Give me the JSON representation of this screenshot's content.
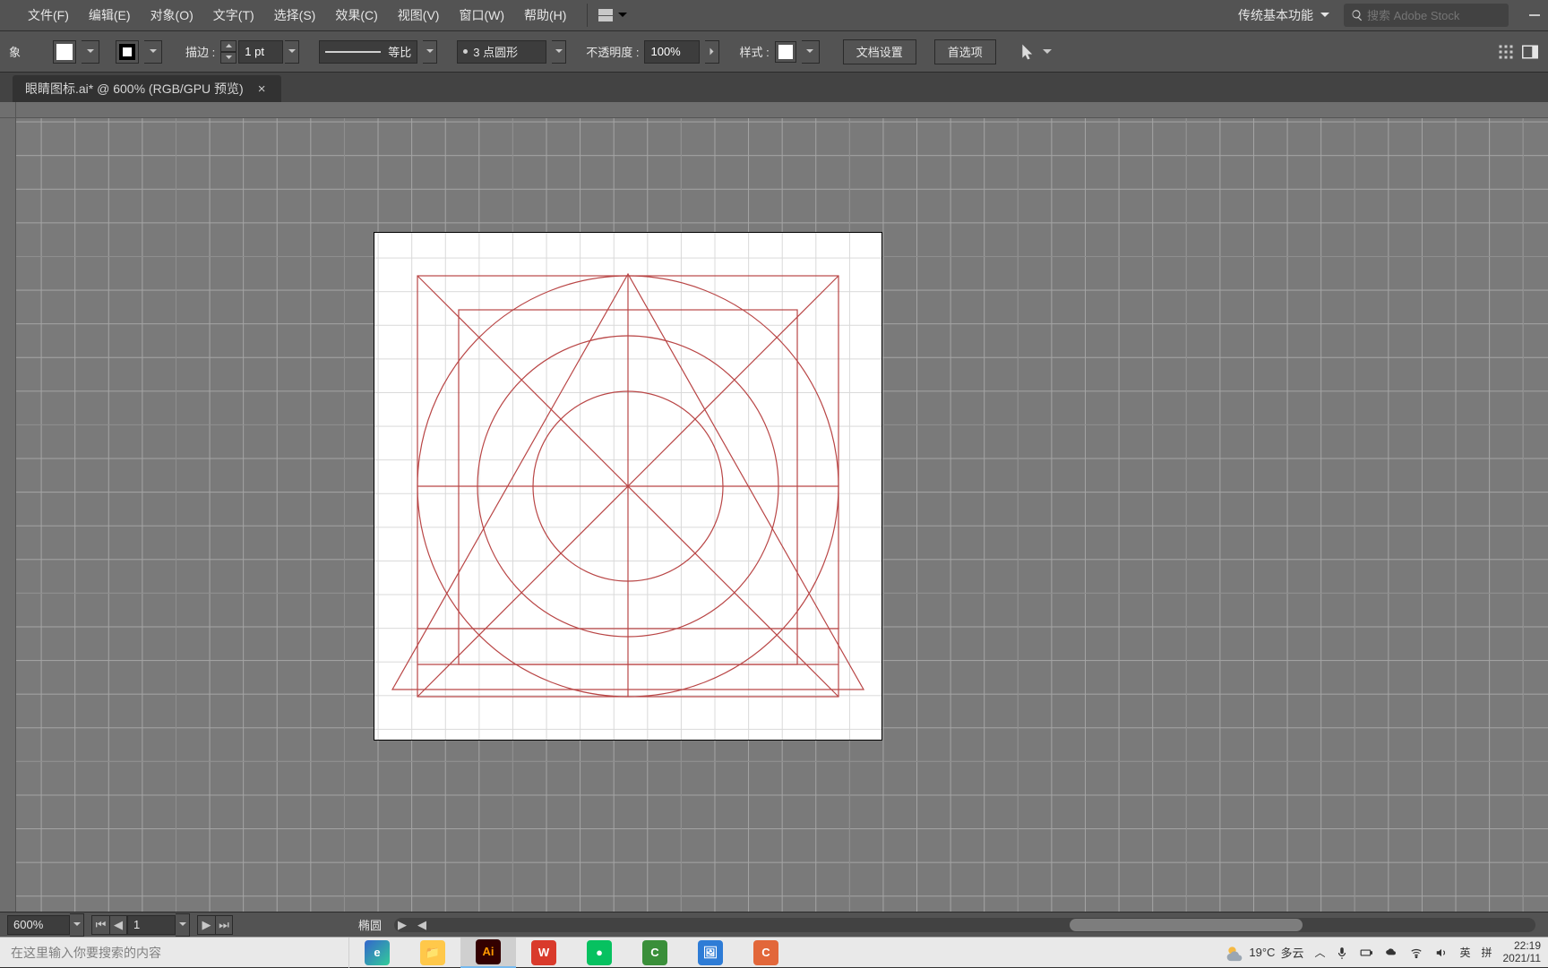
{
  "menu": {
    "file": "文件(F)",
    "edit": "编辑(E)",
    "object": "对象(O)",
    "type": "文字(T)",
    "select": "选择(S)",
    "effect": "效果(C)",
    "view": "视图(V)",
    "window": "窗口(W)",
    "help": "帮助(H)"
  },
  "workspace": {
    "name": "传统基本功能"
  },
  "stock": {
    "placeholder": "搜索 Adobe Stock"
  },
  "control": {
    "label_left": "象",
    "stroke_label": "描边 :",
    "stroke_weight": "1 pt",
    "profile_label": "等比",
    "brush_label": "3 点圆形",
    "opacity_label": "不透明度 :",
    "opacity_value": "100%",
    "style_label": "样式 :",
    "btn_docsetup": "文档设置",
    "btn_prefs": "首选项",
    "fill_color": "#ffffff",
    "stroke_color": "#000000"
  },
  "tab": {
    "title": "眼睛图标.ai* @ 600% (RGB/GPU 预览)"
  },
  "status": {
    "zoom": "600%",
    "page": "1",
    "tool": "椭圆"
  },
  "taskbar": {
    "search_placeholder": "在这里输入你要搜索的内容",
    "weather_temp": "19°C",
    "weather_cond": "多云",
    "ime1": "英",
    "ime2": "拼",
    "time": "22:19",
    "date": "2021/11"
  },
  "apps": {
    "edge": "e",
    "files": "📁",
    "ai": "Ai",
    "wps": "W",
    "wechat": "●",
    "cam": "C",
    "photos": "🖼",
    "c2": "C"
  }
}
